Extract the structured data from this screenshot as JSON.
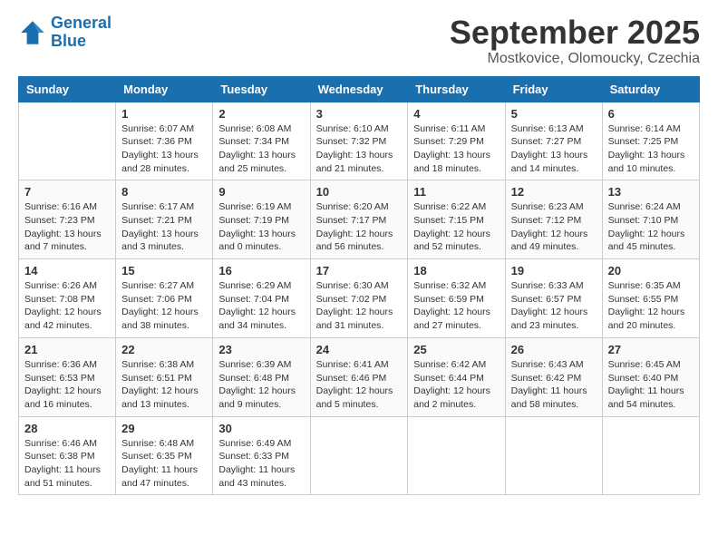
{
  "header": {
    "logo_line1": "General",
    "logo_line2": "Blue",
    "month": "September 2025",
    "location": "Mostkovice, Olomoucky, Czechia"
  },
  "days_of_week": [
    "Sunday",
    "Monday",
    "Tuesday",
    "Wednesday",
    "Thursday",
    "Friday",
    "Saturday"
  ],
  "weeks": [
    [
      {
        "day": "",
        "info": ""
      },
      {
        "day": "1",
        "info": "Sunrise: 6:07 AM\nSunset: 7:36 PM\nDaylight: 13 hours and 28 minutes."
      },
      {
        "day": "2",
        "info": "Sunrise: 6:08 AM\nSunset: 7:34 PM\nDaylight: 13 hours and 25 minutes."
      },
      {
        "day": "3",
        "info": "Sunrise: 6:10 AM\nSunset: 7:32 PM\nDaylight: 13 hours and 21 minutes."
      },
      {
        "day": "4",
        "info": "Sunrise: 6:11 AM\nSunset: 7:29 PM\nDaylight: 13 hours and 18 minutes."
      },
      {
        "day": "5",
        "info": "Sunrise: 6:13 AM\nSunset: 7:27 PM\nDaylight: 13 hours and 14 minutes."
      },
      {
        "day": "6",
        "info": "Sunrise: 6:14 AM\nSunset: 7:25 PM\nDaylight: 13 hours and 10 minutes."
      }
    ],
    [
      {
        "day": "7",
        "info": "Sunrise: 6:16 AM\nSunset: 7:23 PM\nDaylight: 13 hours and 7 minutes."
      },
      {
        "day": "8",
        "info": "Sunrise: 6:17 AM\nSunset: 7:21 PM\nDaylight: 13 hours and 3 minutes."
      },
      {
        "day": "9",
        "info": "Sunrise: 6:19 AM\nSunset: 7:19 PM\nDaylight: 13 hours and 0 minutes."
      },
      {
        "day": "10",
        "info": "Sunrise: 6:20 AM\nSunset: 7:17 PM\nDaylight: 12 hours and 56 minutes."
      },
      {
        "day": "11",
        "info": "Sunrise: 6:22 AM\nSunset: 7:15 PM\nDaylight: 12 hours and 52 minutes."
      },
      {
        "day": "12",
        "info": "Sunrise: 6:23 AM\nSunset: 7:12 PM\nDaylight: 12 hours and 49 minutes."
      },
      {
        "day": "13",
        "info": "Sunrise: 6:24 AM\nSunset: 7:10 PM\nDaylight: 12 hours and 45 minutes."
      }
    ],
    [
      {
        "day": "14",
        "info": "Sunrise: 6:26 AM\nSunset: 7:08 PM\nDaylight: 12 hours and 42 minutes."
      },
      {
        "day": "15",
        "info": "Sunrise: 6:27 AM\nSunset: 7:06 PM\nDaylight: 12 hours and 38 minutes."
      },
      {
        "day": "16",
        "info": "Sunrise: 6:29 AM\nSunset: 7:04 PM\nDaylight: 12 hours and 34 minutes."
      },
      {
        "day": "17",
        "info": "Sunrise: 6:30 AM\nSunset: 7:02 PM\nDaylight: 12 hours and 31 minutes."
      },
      {
        "day": "18",
        "info": "Sunrise: 6:32 AM\nSunset: 6:59 PM\nDaylight: 12 hours and 27 minutes."
      },
      {
        "day": "19",
        "info": "Sunrise: 6:33 AM\nSunset: 6:57 PM\nDaylight: 12 hours and 23 minutes."
      },
      {
        "day": "20",
        "info": "Sunrise: 6:35 AM\nSunset: 6:55 PM\nDaylight: 12 hours and 20 minutes."
      }
    ],
    [
      {
        "day": "21",
        "info": "Sunrise: 6:36 AM\nSunset: 6:53 PM\nDaylight: 12 hours and 16 minutes."
      },
      {
        "day": "22",
        "info": "Sunrise: 6:38 AM\nSunset: 6:51 PM\nDaylight: 12 hours and 13 minutes."
      },
      {
        "day": "23",
        "info": "Sunrise: 6:39 AM\nSunset: 6:48 PM\nDaylight: 12 hours and 9 minutes."
      },
      {
        "day": "24",
        "info": "Sunrise: 6:41 AM\nSunset: 6:46 PM\nDaylight: 12 hours and 5 minutes."
      },
      {
        "day": "25",
        "info": "Sunrise: 6:42 AM\nSunset: 6:44 PM\nDaylight: 12 hours and 2 minutes."
      },
      {
        "day": "26",
        "info": "Sunrise: 6:43 AM\nSunset: 6:42 PM\nDaylight: 11 hours and 58 minutes."
      },
      {
        "day": "27",
        "info": "Sunrise: 6:45 AM\nSunset: 6:40 PM\nDaylight: 11 hours and 54 minutes."
      }
    ],
    [
      {
        "day": "28",
        "info": "Sunrise: 6:46 AM\nSunset: 6:38 PM\nDaylight: 11 hours and 51 minutes."
      },
      {
        "day": "29",
        "info": "Sunrise: 6:48 AM\nSunset: 6:35 PM\nDaylight: 11 hours and 47 minutes."
      },
      {
        "day": "30",
        "info": "Sunrise: 6:49 AM\nSunset: 6:33 PM\nDaylight: 11 hours and 43 minutes."
      },
      {
        "day": "",
        "info": ""
      },
      {
        "day": "",
        "info": ""
      },
      {
        "day": "",
        "info": ""
      },
      {
        "day": "",
        "info": ""
      }
    ]
  ]
}
